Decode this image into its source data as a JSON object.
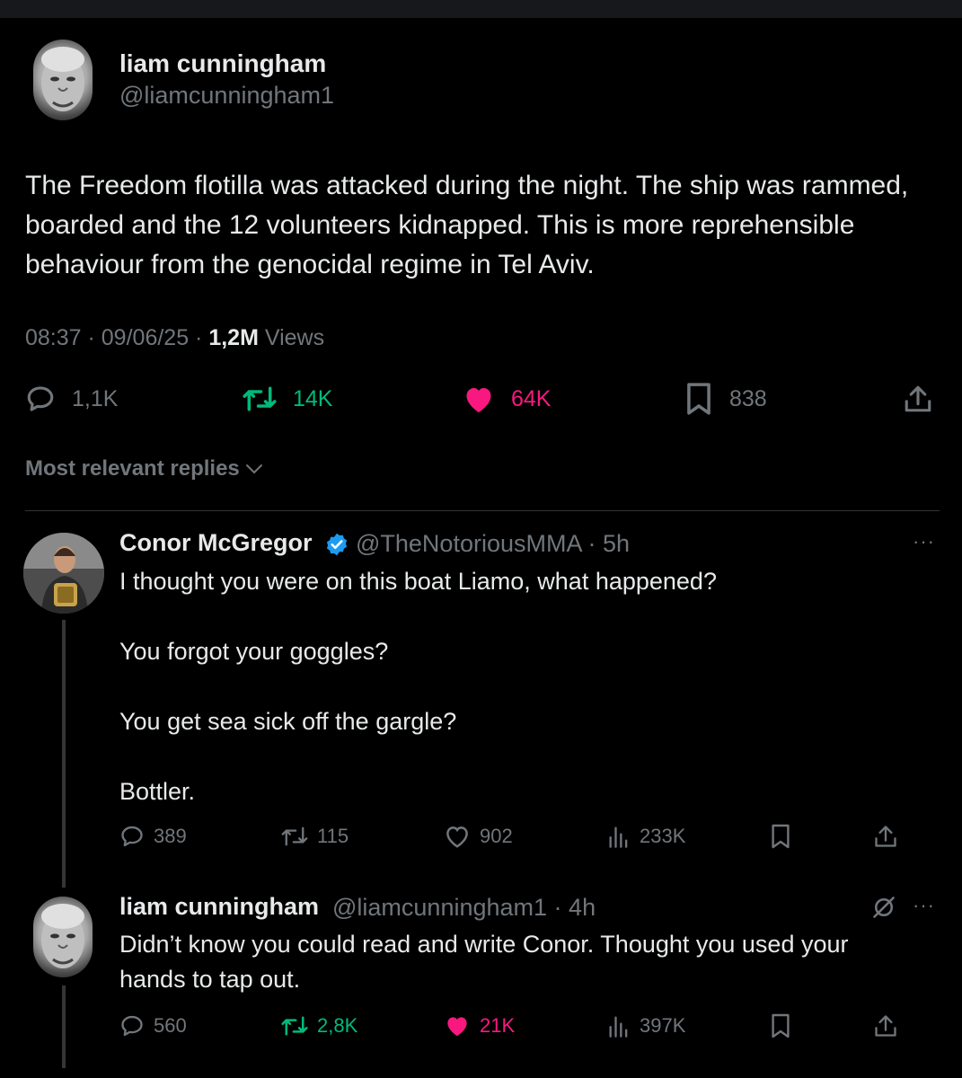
{
  "main_tweet": {
    "author_name": "liam cunningham",
    "author_handle": "@liamcunningham1",
    "text": "The Freedom flotilla was attacked during the night. The ship was rammed, boarded and the 12 volunteers kidnapped. This is more reprehensible behaviour from the genocidal regime in Tel Aviv.",
    "time": "08:37",
    "date": "09/06/25",
    "views_count": "1,2M",
    "views_label": "Views",
    "replies": "1,1K",
    "reposts": "14K",
    "likes": "64K",
    "bookmarks": "838",
    "liked": true,
    "reposted": true
  },
  "sort_label": "Most relevant replies",
  "replies": [
    {
      "author_name": "Conor McGregor",
      "verified": true,
      "author_handle": "@TheNotoriousMMA",
      "time_ago": "5h",
      "paragraphs": [
        "I thought you were on this boat Liamo, what happened?",
        "You forgot your goggles?",
        "You get sea sick off the gargle?",
        "Bottler."
      ],
      "stats": {
        "replies": "389",
        "reposts": "115",
        "likes": "902",
        "views": "233K"
      },
      "more_label": "···"
    },
    {
      "author_name": "liam cunningham",
      "verified": false,
      "author_handle": "@liamcunningham1",
      "time_ago": "4h",
      "paragraphs": [
        "Didn’t know you could read and write Conor. Thought you used your hands to tap out."
      ],
      "stats": {
        "replies": "560",
        "reposts": "2,8K",
        "likes": "21K",
        "views": "397K"
      },
      "liked": true,
      "reposted": true,
      "more_label": "···"
    }
  ],
  "colors": {
    "background": "#000000",
    "text": "#e7e9ea",
    "secondary": "#71767b",
    "repost_green": "#00ba7c",
    "like_pink": "#f91880",
    "verified_blue": "#1d9bf0"
  },
  "icons": [
    "reply-icon",
    "repost-icon",
    "like-icon",
    "bookmark-icon",
    "share-icon",
    "views-icon",
    "verified-badge-icon",
    "chevron-down-icon",
    "more-icon",
    "grok-icon"
  ]
}
